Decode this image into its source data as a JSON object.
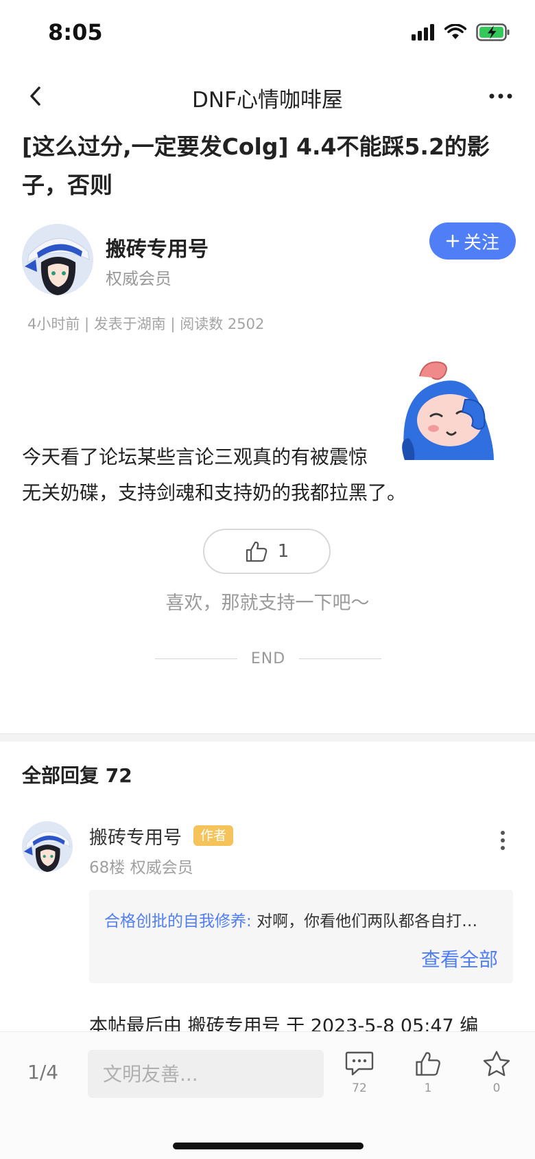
{
  "status_bar": {
    "time": "8:05"
  },
  "nav": {
    "title": "DNF心情咖啡屋"
  },
  "post": {
    "title": "[这么过分,一定要发Colg] 4.4不能踩5.2的影子，否则",
    "author": {
      "name": "搬砖专用号",
      "role": "权威会员",
      "follow_label": "关注"
    },
    "meta": "4小时前 | 发表于湖南 | 阅读数 2502",
    "body_line1": "今天看了论坛某些言论三观真的有被震惊",
    "body_line2": "无关奶碟，支持剑魂和支持奶的我都拉黑了。",
    "like_count": "1",
    "like_hint": "喜欢，那就支持一下吧～",
    "end_label": "END"
  },
  "replies": {
    "heading": "全部回复",
    "count": "72",
    "items": [
      {
        "name": "搬砖专用号",
        "tag": "作者",
        "meta": "68楼 权威会员",
        "quote_user": "合格创批的自我修养:",
        "quote_text": "对啊，你看他们两队都各自打…",
        "view_all": "查看全部",
        "edit_note": "本帖最后由 搬砖专用号 于 2023-5-8 05:47 编"
      }
    ]
  },
  "bottom_bar": {
    "page": "1/4",
    "input_placeholder": "文明友善...",
    "comments": "72",
    "likes": "1",
    "favorites": "0"
  },
  "colors": {
    "accent": "#4f7ef6",
    "author_tag": "#f6c25a"
  }
}
